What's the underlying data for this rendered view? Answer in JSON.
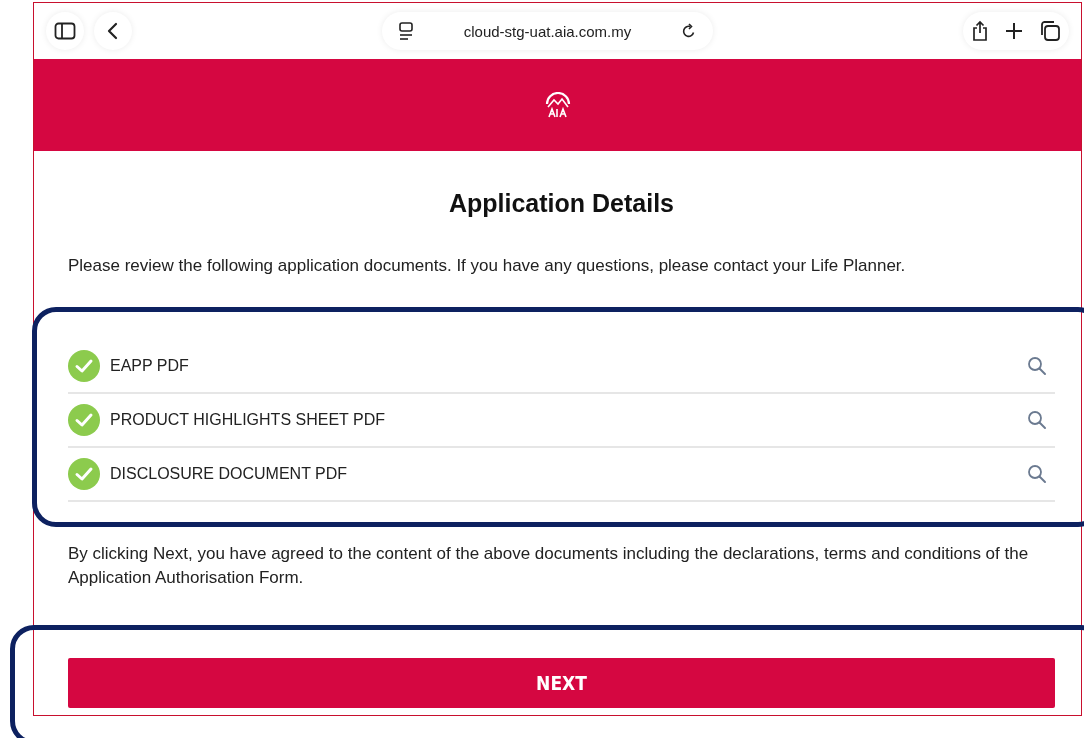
{
  "browser": {
    "url": "cloud-stg-uat.aia.com.my"
  },
  "page": {
    "title": "Application Details",
    "intro": "Please review the following application documents. If you have any questions, please contact your Life Planner.",
    "documents": [
      {
        "name": "EAPP PDF",
        "checked": true
      },
      {
        "name": "PRODUCT HIGHLIGHTS SHEET PDF",
        "checked": true
      },
      {
        "name": "DISCLOSURE DOCUMENT PDF",
        "checked": true
      }
    ],
    "agreement": "By clicking Next, you have agreed to the content of the above documents including the declarations, terms and conditions of the Application Authorisation Form.",
    "button": "NEXT"
  }
}
